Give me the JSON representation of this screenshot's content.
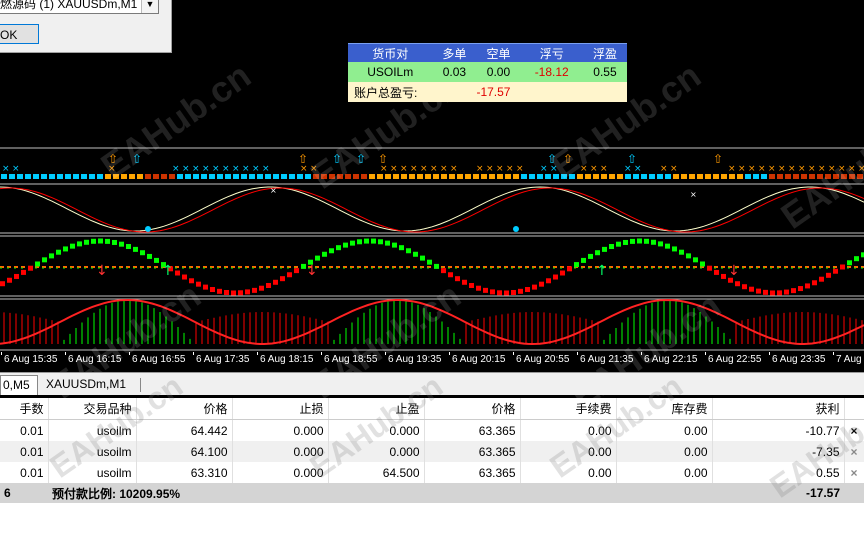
{
  "dialog": {
    "select_text": "燃源码 (1) XAUUSDm,M1",
    "ok_label": "OK"
  },
  "stats_panel": {
    "headers": [
      "货币对",
      "多单",
      "空单",
      "浮亏",
      "浮盈"
    ],
    "row": {
      "symbol": "USOILm",
      "buy": "0.03",
      "sell": "0.00",
      "loss": "-18.12",
      "profit": "0.55"
    },
    "total_label": "账户总盈亏:",
    "total_value": "-17.57"
  },
  "time_axis": [
    "6 Aug 15:35",
    "6 Aug 16:15",
    "6 Aug 16:55",
    "6 Aug 17:35",
    "6 Aug 18:15",
    "6 Aug 18:55",
    "6 Aug 19:35",
    "6 Aug 20:15",
    "6 Aug 20:55",
    "6 Aug 21:35",
    "6 Aug 22:15",
    "6 Aug 22:55",
    "6 Aug 23:35",
    "7 Aug"
  ],
  "tabs": [
    "0,M5",
    "XAUUSDm,M1"
  ],
  "orders": {
    "columns": [
      "手数",
      "交易品种",
      "价格",
      "止损",
      "止盈",
      "价格",
      "手续费",
      "库存费",
      "获利"
    ],
    "rows": [
      [
        "0.01",
        "usoilm",
        "64.442",
        "0.000",
        "0.000",
        "63.365",
        "0.00",
        "0.00",
        "-10.77"
      ],
      [
        "0.01",
        "usoilm",
        "64.100",
        "0.000",
        "0.000",
        "63.365",
        "0.00",
        "0.00",
        "-7.35"
      ],
      [
        "0.01",
        "usoilm",
        "63.310",
        "0.000",
        "64.500",
        "63.365",
        "0.00",
        "0.00",
        "0.55"
      ]
    ],
    "close_symbol": "×",
    "summary_prefix": "6",
    "summary_text": "预付款比例: 10209.95%",
    "summary_total": "-17.57"
  },
  "watermark": "EAHub.cn",
  "colors": {
    "header_blue": "#3a5fcd",
    "row_green": "#90ee90",
    "total_yellow": "#fff5cc",
    "loss_red": "#e00000",
    "indicator_green": "#00ff00",
    "indicator_red": "#ff0000",
    "signal_cyan": "#00ccff",
    "signal_orange": "#ffa500"
  }
}
